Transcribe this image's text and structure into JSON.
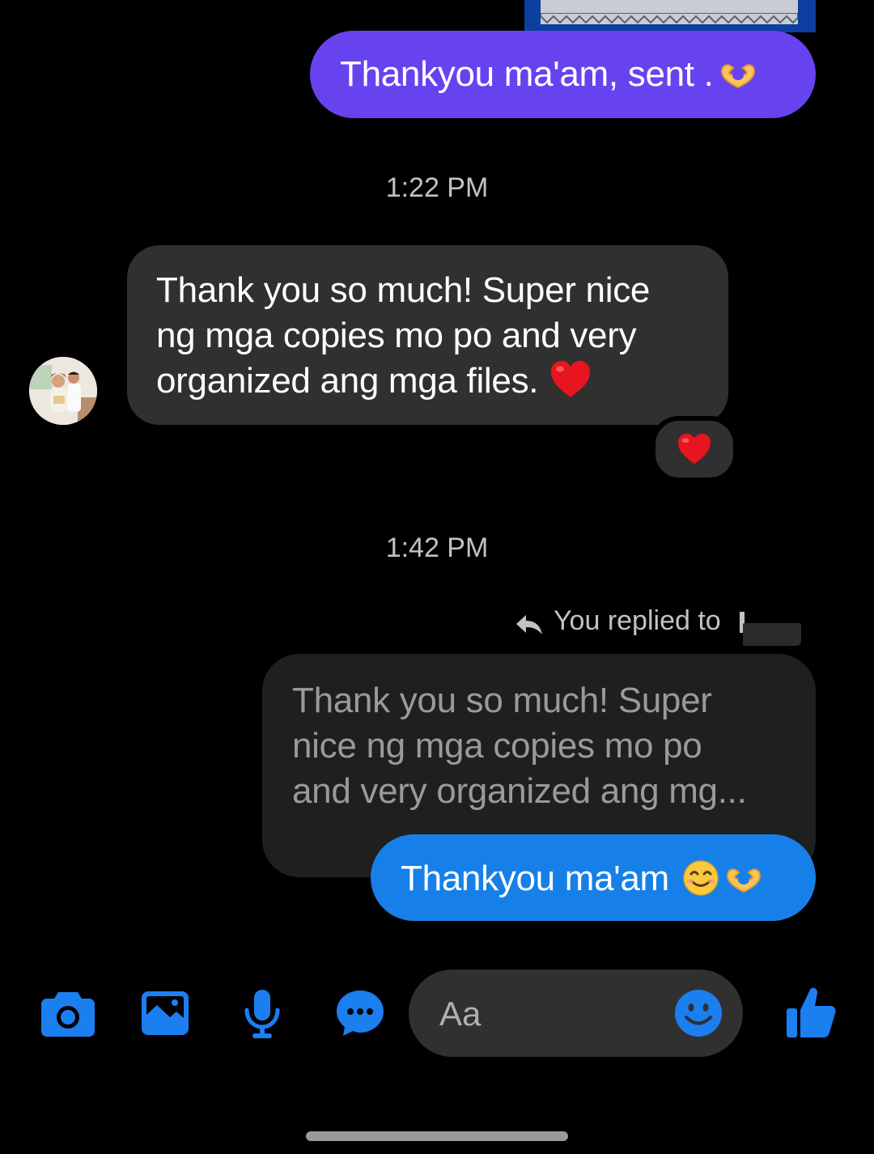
{
  "messages": {
    "sent_1": "Thankyou ma'am, sent .",
    "timestamp_1": "1:22 PM",
    "received_1_lines": [
      "Thank you so much! Super nice",
      "ng mga copies mo po and very",
      "organized ang mga files."
    ],
    "timestamp_2": "1:42 PM",
    "reply_label": "You replied to",
    "quoted_lines": [
      "Thank you so much! Super",
      "nice ng mga copies mo po",
      "and very organized ang mg..."
    ],
    "sent_2": "Thankyou ma'am"
  },
  "composer": {
    "placeholder": "Aa"
  },
  "icons": [
    "camera-icon",
    "image-icon",
    "microphone-icon",
    "chat-options-icon",
    "emoji-icon",
    "thumbs-up-icon"
  ],
  "colors": {
    "sent_bubble_purple": "#6743f0",
    "sent_bubble_blue": "#1680e8",
    "received_bubble": "#303030",
    "accent": "#1b7ff0"
  }
}
